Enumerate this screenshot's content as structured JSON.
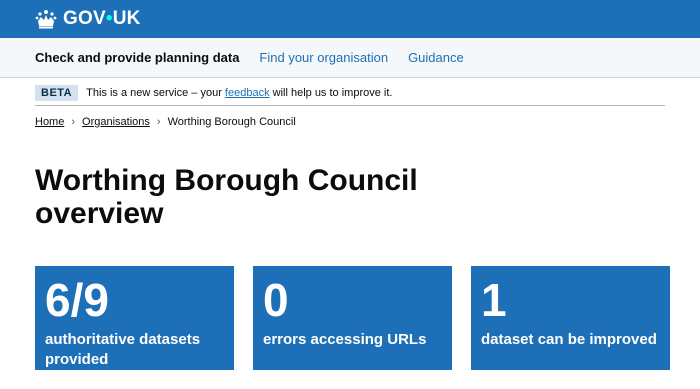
{
  "header": {
    "logo_text_left": "GOV",
    "logo_dot": "•",
    "logo_text_right": "UK"
  },
  "service_nav": {
    "service_name": "Check and provide planning data",
    "links": [
      {
        "label": "Find your organisation"
      },
      {
        "label": "Guidance"
      }
    ]
  },
  "phase_banner": {
    "tag": "BETA",
    "text_before": "This is a new service – your ",
    "link": "feedback",
    "text_after": " will help us to improve it."
  },
  "breadcrumbs": {
    "home": "Home",
    "organisations": "Organisations",
    "current": "Worthing Borough Council"
  },
  "page": {
    "title": "Worthing Borough Council overview"
  },
  "cards": [
    {
      "number": "6/9",
      "label": "authoritative datasets provided"
    },
    {
      "number": "0",
      "label": "errors accessing URLs"
    },
    {
      "number": "1",
      "label": "dataset can be improved"
    }
  ],
  "colors": {
    "brand_blue": "#1d70b8",
    "link_blue": "#1d70b8",
    "text": "#0b0c0c"
  }
}
